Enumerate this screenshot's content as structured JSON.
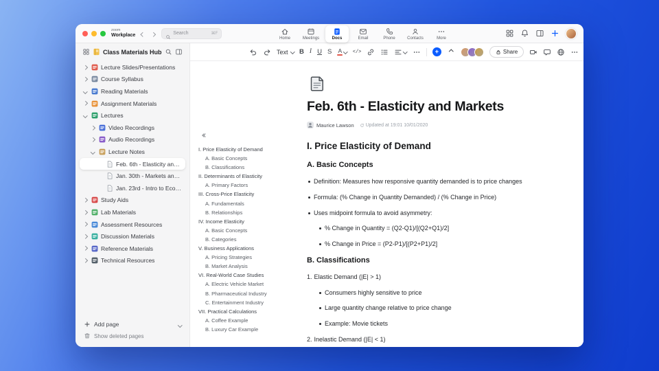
{
  "accent": "#0B5CFF",
  "titlebar": {
    "brand_top": "zoom",
    "brand_bottom": "Workplace",
    "search_label": "Search",
    "search_shortcut": "⌘F",
    "tabs": [
      {
        "id": "home",
        "label": "Home",
        "active": false
      },
      {
        "id": "meetings",
        "label": "Meetings",
        "active": false
      },
      {
        "id": "docs",
        "label": "Docs",
        "active": true
      },
      {
        "id": "email",
        "label": "Email",
        "active": false
      },
      {
        "id": "phone",
        "label": "Phone",
        "active": false
      },
      {
        "id": "contacts",
        "label": "Contacts",
        "active": false
      },
      {
        "id": "more",
        "label": "More",
        "active": false
      }
    ],
    "right_icons": [
      "apps",
      "notifications",
      "sidebar-toggle",
      "new"
    ]
  },
  "sidebar": {
    "title": "Class Materials Hub",
    "items": [
      {
        "label": "Lecture Slides/Presentations",
        "level": 0,
        "chevron": "right",
        "type": "folder",
        "color": "#e05d4f",
        "selected": false
      },
      {
        "label": "Course Syllabus",
        "level": 0,
        "chevron": "right",
        "type": "folder",
        "color": "#7a8aa0",
        "selected": false
      },
      {
        "label": "Reading Materials",
        "level": 0,
        "chevron": "down",
        "type": "folder",
        "color": "#4a7bd0",
        "selected": false
      },
      {
        "label": "Assignment Materials",
        "level": 0,
        "chevron": "right",
        "type": "folder",
        "color": "#e8923a",
        "selected": false
      },
      {
        "label": "Lectures",
        "level": 0,
        "chevron": "down",
        "type": "folder",
        "color": "#2fa06d",
        "selected": false
      },
      {
        "label": "Video Recordings",
        "level": 1,
        "chevron": "right",
        "type": "folder",
        "color": "#4a6fd8",
        "selected": false
      },
      {
        "label": "Audio Recordings",
        "level": 1,
        "chevron": "right",
        "type": "folder",
        "color": "#8a5ec9",
        "selected": false
      },
      {
        "label": "Lecture Notes",
        "level": 1,
        "chevron": "down",
        "type": "folder",
        "color": "#c9a15e",
        "selected": false
      },
      {
        "label": "Feb. 6th - Elasticity and M...",
        "level": 2,
        "chevron": null,
        "type": "page",
        "color": "#9aa0a8",
        "selected": true
      },
      {
        "label": "Jan. 30th - Markets and P...",
        "level": 2,
        "chevron": null,
        "type": "page",
        "color": "#9aa0a8",
        "selected": false
      },
      {
        "label": "Jan. 23rd - Intro to Econo...",
        "level": 2,
        "chevron": null,
        "type": "page",
        "color": "#9aa0a8",
        "selected": false
      },
      {
        "label": "Study Aids",
        "level": 0,
        "chevron": "right",
        "type": "folder",
        "color": "#d84a4a",
        "selected": false
      },
      {
        "label": "Lab Materials",
        "level": 0,
        "chevron": "right",
        "type": "folder",
        "color": "#52b06a",
        "selected": false
      },
      {
        "label": "Assessment Resources",
        "level": 0,
        "chevron": "right",
        "type": "folder",
        "color": "#4a8ad8",
        "selected": false
      },
      {
        "label": "Discussion Materials",
        "level": 0,
        "chevron": "right",
        "type": "folder",
        "color": "#3ab0a0",
        "selected": false
      },
      {
        "label": "Reference Materials",
        "level": 0,
        "chevron": "right",
        "type": "folder",
        "color": "#5868c8",
        "selected": false
      },
      {
        "label": "Technical Resources",
        "level": 0,
        "chevron": "right",
        "type": "folder",
        "color": "#55606a",
        "selected": false
      }
    ],
    "add_page_label": "Add page",
    "show_deleted_label": "Show deleted pages"
  },
  "toolbar": {
    "text_style_label": "Text",
    "share_label": "Share",
    "left_items": [
      {
        "kind": "icon",
        "name": "undo"
      },
      {
        "kind": "icon",
        "name": "redo"
      },
      {
        "kind": "dropdown",
        "name": "text-style"
      },
      {
        "kind": "glyph",
        "name": "bold",
        "glyph": "B"
      },
      {
        "kind": "glyph",
        "name": "italic",
        "glyph": "I"
      },
      {
        "kind": "glyph",
        "name": "underline",
        "glyph": "U"
      },
      {
        "kind": "glyph",
        "name": "strikethrough",
        "glyph": "S"
      },
      {
        "kind": "fontcolor",
        "name": "font-color",
        "glyph": "A"
      },
      {
        "kind": "mono",
        "name": "code",
        "glyph": "</>"
      },
      {
        "kind": "icon",
        "name": "link"
      },
      {
        "kind": "icon",
        "name": "bullet-list"
      },
      {
        "kind": "icon-chev",
        "name": "align"
      },
      {
        "kind": "dots",
        "name": "more-formats"
      },
      {
        "kind": "divider"
      },
      {
        "kind": "insert",
        "name": "insert"
      },
      {
        "kind": "chev-up",
        "name": "collapse-toolbar"
      }
    ],
    "collaborator_colors": [
      "#d49a6a",
      "#8a63c9",
      "#c9a04a"
    ],
    "right_icons": [
      "video",
      "comment",
      "language",
      "more-options"
    ]
  },
  "document": {
    "title": "Feb. 6th - Elasticity and Markets",
    "author": "Maurice Lawson",
    "updated": "Updated at 19:01 10/01/2020"
  },
  "toc": {
    "items": [
      {
        "label": "I. Price Elasticity of Demand",
        "level": 0
      },
      {
        "label": "A. Basic Concepts",
        "level": 1
      },
      {
        "label": "B. Classifications",
        "level": 1
      },
      {
        "label": "II. Determinants of Elasticity",
        "level": 0
      },
      {
        "label": "A. Primary Factors",
        "level": 1
      },
      {
        "label": "III. Cross-Price Elasticity",
        "level": 0
      },
      {
        "label": "A. Fundamentals",
        "level": 1
      },
      {
        "label": "B. Relationships",
        "level": 1
      },
      {
        "label": "IV. Income Elasticity",
        "level": 0
      },
      {
        "label": "A. Basic Concepts",
        "level": 1
      },
      {
        "label": "B. Categories",
        "level": 1
      },
      {
        "label": "V. Business Applications",
        "level": 0
      },
      {
        "label": "A. Pricing Strategies",
        "level": 1
      },
      {
        "label": "B. Market Analysis",
        "level": 1
      },
      {
        "label": "VI. Real-World Case Studies",
        "level": 0
      },
      {
        "label": "A. Electric Vehicle Market",
        "level": 1
      },
      {
        "label": "B. Pharmaceutical Industry",
        "level": 1
      },
      {
        "label": "C. Entertainment Industry",
        "level": 1
      },
      {
        "label": "VII. Practical Calculations",
        "level": 0
      },
      {
        "label": "A. Coffee Example",
        "level": 1
      },
      {
        "label": "B. Luxury Car Example",
        "level": 1
      }
    ]
  },
  "content": {
    "heading1": "I. Price Elasticity of Demand",
    "sectionA": {
      "heading": "A. Basic Concepts",
      "bullets": [
        {
          "level": 0,
          "text": "Definition: Measures how responsive quantity demanded is to price changes"
        },
        {
          "level": 0,
          "text": "Formula: (% Change in Quantity Demanded) / (% Change in Price)"
        },
        {
          "level": 0,
          "text": "Uses midpoint formula to avoid asymmetry:"
        },
        {
          "level": 1,
          "text": "% Change in Quantity = (Q2-Q1)/[(Q2+Q1)/2]"
        },
        {
          "level": 1,
          "text": "% Change in Price = (P2-P1)/[(P2+P1)/2]"
        }
      ]
    },
    "sectionB": {
      "heading": "B. Classifications",
      "items": [
        {
          "number": "1.",
          "text": "Elastic Demand (|E| > 1)",
          "bullets": [
            "Consumers highly sensitive to price",
            "Large quantity change relative to price change",
            "Example: Movie tickets"
          ]
        },
        {
          "number": "2.",
          "text": "Inelastic Demand (|E| < 1)",
          "bullets": []
        }
      ]
    }
  }
}
